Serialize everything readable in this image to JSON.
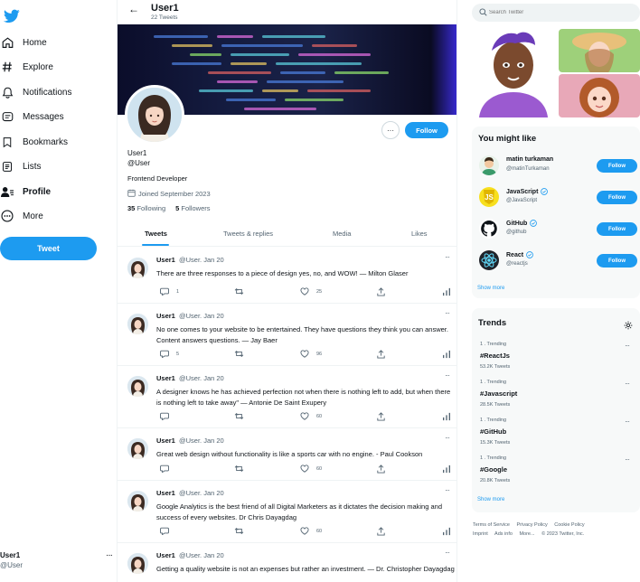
{
  "nav": {
    "items": [
      {
        "label": "Home",
        "icon": "home-icon"
      },
      {
        "label": "Explore",
        "icon": "hashtag-icon"
      },
      {
        "label": "Notifications",
        "icon": "bell-icon"
      },
      {
        "label": "Messages",
        "icon": "message-icon"
      },
      {
        "label": "Bookmarks",
        "icon": "bookmark-icon"
      },
      {
        "label": "Lists",
        "icon": "list-icon"
      },
      {
        "label": "Profile",
        "icon": "profile-icon"
      },
      {
        "label": "More",
        "icon": "more-circle-icon"
      }
    ],
    "tweet_button": "Tweet",
    "account": {
      "name": "User1",
      "handle": "@User"
    }
  },
  "header": {
    "back": "←",
    "title": "User1",
    "subtitle": "22 Tweets"
  },
  "profile": {
    "name": "User1",
    "handle": "@User",
    "bio": "Frontend Developer",
    "joined": "Joined September 2023",
    "following_count": "35",
    "following_label": "Following",
    "followers_count": "5",
    "followers_label": "Followers",
    "follow_button": "Follow",
    "more": "···"
  },
  "tabs": [
    "Tweets",
    "Tweets & replies",
    "Media",
    "Likes"
  ],
  "tweets": [
    {
      "name": "User1",
      "meta": "@User. Jan 20",
      "text": "There are three responses to a piece of design yes, no, and WOW! — Milton Glaser",
      "replies": "1",
      "likes": "25"
    },
    {
      "name": "User1",
      "meta": "@User. Jan 20",
      "text": "No one comes to your website to be entertained. They have questions they think you can answer. Content answers questions. — Jay Baer",
      "replies": "5",
      "likes": "96"
    },
    {
      "name": "User1",
      "meta": "@User. Jan 20",
      "text": "A designer knows he has achieved perfection not when there is nothing left to add, but when there is nothing left to take away\" — Antonie De Saint Exupery",
      "replies": "",
      "likes": "60"
    },
    {
      "name": "User1",
      "meta": "@User. Jan 20",
      "text": "Great web design without functionality is like a sports car with no engine. - Paul Cookson",
      "replies": "",
      "likes": "60"
    },
    {
      "name": "User1",
      "meta": "@User. Jan 20",
      "text": "Google Analytics is the best friend of all Digital Marketers as it dictates the decision making and success of every websites. Dr Chris Dayagdag",
      "replies": "",
      "likes": "60"
    },
    {
      "name": "User1",
      "meta": "@User. Jan 20",
      "text": "Getting a quality website is not an expenses but rather an investment. — Dr. Christopher Dayagdag",
      "replies": "",
      "likes": ""
    }
  ],
  "search": {
    "placeholder": "Search Twitter"
  },
  "suggestions": {
    "title": "You might like",
    "follow_label": "Follow",
    "items": [
      {
        "name": "matin turkaman",
        "handle": "@matinTurkaman",
        "verified": false
      },
      {
        "name": "JavaScript",
        "handle": "@JavaScript",
        "verified": true
      },
      {
        "name": "GitHub",
        "handle": "@github",
        "verified": true
      },
      {
        "name": "React",
        "handle": "@reactjs",
        "verified": true
      }
    ],
    "show_more": "Show more"
  },
  "trends": {
    "title": "Trends",
    "items": [
      {
        "context": "1 . Trending",
        "tag": "#ReactJs",
        "count": "53.2K Tweets"
      },
      {
        "context": "1 . Trending",
        "tag": "#Javascript",
        "count": "28.5K Tweets"
      },
      {
        "context": "1 . Trending",
        "tag": "#GitHub",
        "count": "15.3K Tweets"
      },
      {
        "context": "1 . Trending",
        "tag": "#Google",
        "count": "20.8K Tweets"
      }
    ],
    "show_more": "Show more"
  },
  "footer": {
    "terms": "Terms of Service",
    "privacy": "Privacy Policy",
    "cookie": "Cookie Policy",
    "imprint": "Imprint",
    "ads": "Ads info",
    "more": "More...",
    "copyright": "© 2023 Twitter, Inc."
  },
  "colors": {
    "accent": "#1d9bf0",
    "text": "#0f1419",
    "muted": "#536471",
    "panel": "#f7f9f9"
  }
}
